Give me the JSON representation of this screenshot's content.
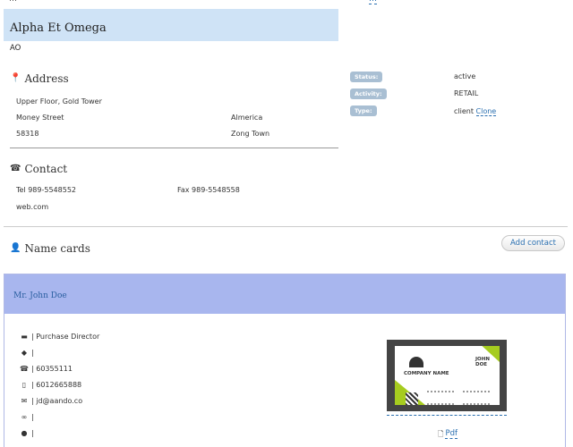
{
  "header": {
    "cut_text": "…",
    "cut_link": "…"
  },
  "company": {
    "name": "Alpha Et Omega",
    "short": "AO"
  },
  "address": {
    "title": "Address",
    "line1": "Upper Floor, Gold Tower",
    "street": "Money Street",
    "country": "Almerica",
    "zip": "58318",
    "town": "Zong Town"
  },
  "meta": {
    "status_label": "Status:",
    "status_value": "active",
    "activity_label": "Activity:",
    "activity_value": "RETAIL",
    "type_label": "Type:",
    "type_value": "client",
    "clone_label": "Clone"
  },
  "contact": {
    "title": "Contact",
    "tel": "Tel 989-5548552",
    "fax": "Fax 989-5548558",
    "web": "web.com"
  },
  "name_cards": {
    "title": "Name cards",
    "add_label": "Add contact"
  },
  "card": {
    "person": "Mr. John Doe",
    "position": "| Purchase Director",
    "tag": "|",
    "phone": "| 60355111",
    "mobile": "| 6012665888",
    "email": "| jd@aando.co",
    "link": "|",
    "chat": "|",
    "biz_company": "COMPANY NAME",
    "biz_name": "JOHN DOE",
    "pdf_label": "Pdf"
  },
  "icons": {
    "address": "map-marker-icon",
    "contact": "phone-icon",
    "name_cards": "user-icon"
  }
}
